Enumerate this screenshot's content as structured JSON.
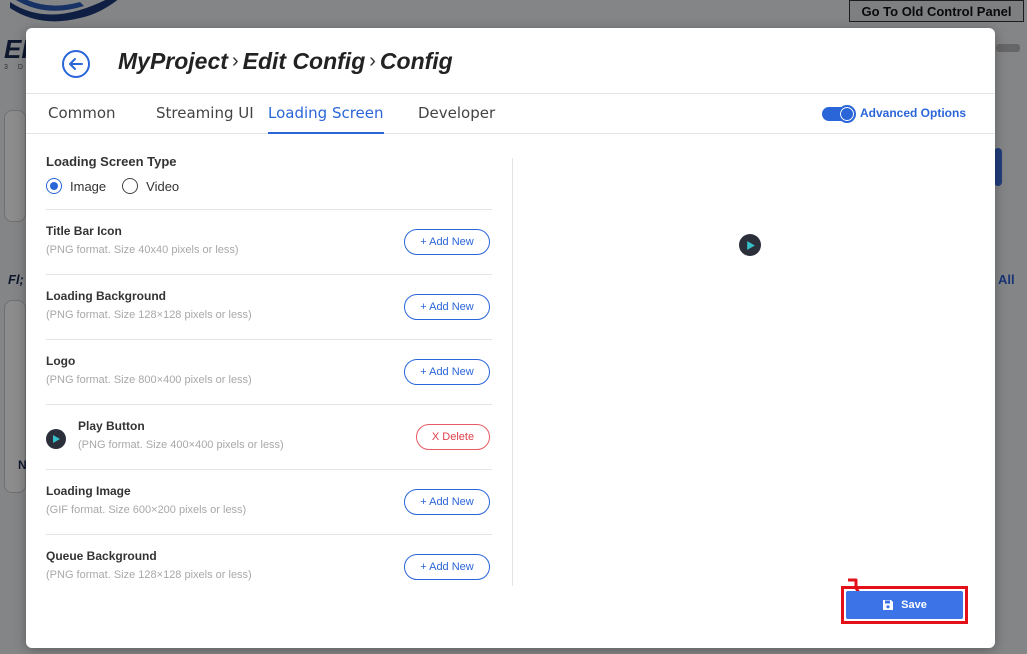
{
  "background": {
    "logo_letters": "EI",
    "logo_sub": "3 D",
    "old_panel_button": "Go To Old Control Panel",
    "side_text": "Fl;",
    "side_text_2": "N",
    "right_link": "All"
  },
  "modal": {
    "breadcrumb": [
      "MyProject",
      "Edit Config",
      "Config"
    ],
    "breadcrumb_sep": "›",
    "tabs": [
      {
        "label": "Common",
        "active": false
      },
      {
        "label": "Streaming UI",
        "active": false
      },
      {
        "label": "Loading Screen",
        "active": true
      },
      {
        "label": "Developer",
        "active": false
      }
    ],
    "advanced_options_label": "Advanced Options",
    "loading_screen_type": {
      "title": "Loading Screen Type",
      "options": [
        {
          "label": "Image",
          "checked": true
        },
        {
          "label": "Video",
          "checked": false
        }
      ]
    },
    "assets": [
      {
        "title": "Title Bar Icon",
        "hint": "(PNG format. Size 40x40 pixels or less)",
        "action": "+ Add New",
        "has_file": false
      },
      {
        "title": "Loading Background",
        "hint": "(PNG format. Size 128×128 pixels or less)",
        "action": "+ Add New",
        "has_file": false
      },
      {
        "title": "Logo",
        "hint": "(PNG format. Size 800×400 pixels or less)",
        "action": "+ Add New",
        "has_file": false
      },
      {
        "title": "Play Button",
        "hint": "(PNG format. Size 400×400 pixels or less)",
        "action": "X Delete",
        "has_file": true
      },
      {
        "title": "Loading Image",
        "hint": "(GIF format. Size 600×200 pixels or less)",
        "action": "+ Add New",
        "has_file": false
      },
      {
        "title": "Queue Background",
        "hint": "(PNG format. Size 128×128 pixels or less)",
        "action": "+ Add New",
        "has_file": false
      }
    ],
    "save_label": "Save"
  },
  "colors": {
    "accent": "#2b66d9",
    "delete": "#e0404c",
    "highlight": "#e3101a"
  }
}
